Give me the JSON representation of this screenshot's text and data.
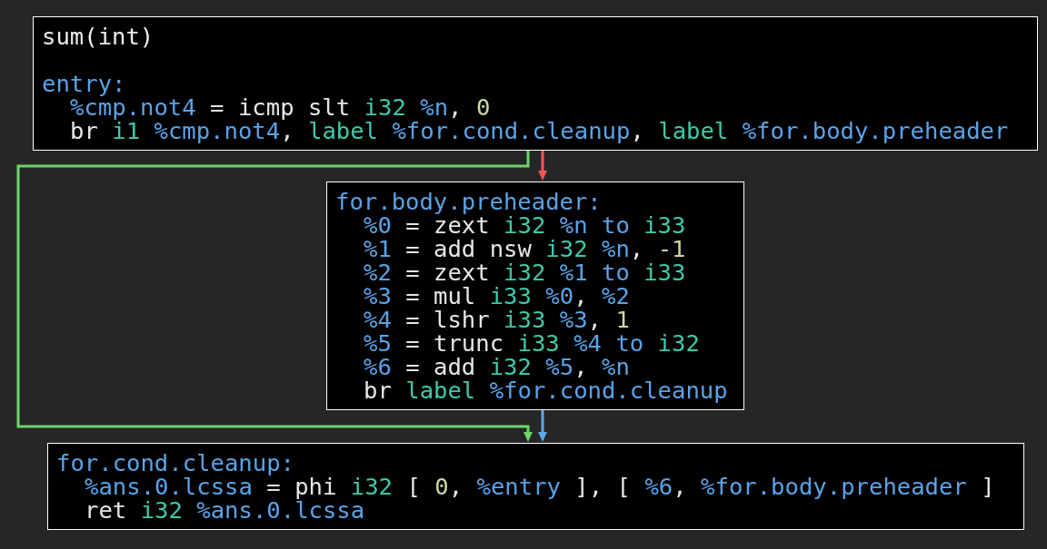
{
  "blocks": [
    {
      "title": "sum(int)",
      "label": "entry:",
      "instructions": [
        [
          {
            "t": "%cmp.not4",
            "kind": "name"
          },
          {
            "t": " = icmp slt ",
            "kind": "plain"
          },
          {
            "t": "i32",
            "kind": "type"
          },
          {
            "t": " %n",
            "kind": "name"
          },
          {
            "t": ", ",
            "kind": "plain"
          },
          {
            "t": "0",
            "kind": "number"
          }
        ],
        [
          {
            "t": "br ",
            "kind": "plain"
          },
          {
            "t": "i1",
            "kind": "type"
          },
          {
            "t": " %cmp.not4",
            "kind": "name"
          },
          {
            "t": ", ",
            "kind": "plain"
          },
          {
            "t": "label",
            "kind": "type"
          },
          {
            "t": " %for.cond.cleanup",
            "kind": "name"
          },
          {
            "t": ", ",
            "kind": "plain"
          },
          {
            "t": "label",
            "kind": "type"
          },
          {
            "t": " %for.body.preheader",
            "kind": "name"
          }
        ]
      ],
      "edges": [
        {
          "kind": "skip",
          "color": "#6ad66a"
        },
        {
          "kind": "next",
          "color": "#f05555"
        }
      ]
    },
    {
      "label": "for.body.preheader:",
      "instructions": [
        [
          {
            "t": "%0",
            "kind": "name"
          },
          {
            "t": " = zext ",
            "kind": "plain"
          },
          {
            "t": "i32",
            "kind": "type"
          },
          {
            "t": " %n to",
            "kind": "name"
          },
          {
            "t": " i33",
            "kind": "type"
          }
        ],
        [
          {
            "t": "%1",
            "kind": "name"
          },
          {
            "t": " = add nsw ",
            "kind": "plain"
          },
          {
            "t": "i32",
            "kind": "type"
          },
          {
            "t": " %n",
            "kind": "name"
          },
          {
            "t": ", ",
            "kind": "plain"
          },
          {
            "t": "-1",
            "kind": "number"
          }
        ],
        [
          {
            "t": "%2",
            "kind": "name"
          },
          {
            "t": " = zext ",
            "kind": "plain"
          },
          {
            "t": "i32",
            "kind": "type"
          },
          {
            "t": " %1 to",
            "kind": "name"
          },
          {
            "t": " i33",
            "kind": "type"
          }
        ],
        [
          {
            "t": "%3",
            "kind": "name"
          },
          {
            "t": " = mul ",
            "kind": "plain"
          },
          {
            "t": "i33",
            "kind": "type"
          },
          {
            "t": " %0",
            "kind": "name"
          },
          {
            "t": ", ",
            "kind": "plain"
          },
          {
            "t": "%2",
            "kind": "name"
          }
        ],
        [
          {
            "t": "%4",
            "kind": "name"
          },
          {
            "t": " = lshr ",
            "kind": "plain"
          },
          {
            "t": "i33",
            "kind": "type"
          },
          {
            "t": " %3",
            "kind": "name"
          },
          {
            "t": ", ",
            "kind": "plain"
          },
          {
            "t": "1",
            "kind": "number"
          }
        ],
        [
          {
            "t": "%5",
            "kind": "name"
          },
          {
            "t": " = trunc ",
            "kind": "plain"
          },
          {
            "t": "i33",
            "kind": "type"
          },
          {
            "t": " %4 to",
            "kind": "name"
          },
          {
            "t": " i32",
            "kind": "type"
          }
        ],
        [
          {
            "t": "%6",
            "kind": "name"
          },
          {
            "t": " = add ",
            "kind": "plain"
          },
          {
            "t": "i32",
            "kind": "type"
          },
          {
            "t": " %5",
            "kind": "name"
          },
          {
            "t": ", ",
            "kind": "plain"
          },
          {
            "t": "%n",
            "kind": "name"
          }
        ],
        [
          {
            "t": "br ",
            "kind": "plain"
          },
          {
            "t": "label",
            "kind": "type"
          },
          {
            "t": " %for.cond.cleanup",
            "kind": "name"
          }
        ]
      ],
      "edges": [
        {
          "kind": "next",
          "color": "#5aa8ec"
        }
      ]
    },
    {
      "label": "for.cond.cleanup:",
      "instructions": [
        [
          {
            "t": "%ans.0.lcssa",
            "kind": "name"
          },
          {
            "t": " = phi ",
            "kind": "plain"
          },
          {
            "t": "i32",
            "kind": "type"
          },
          {
            "t": " [ ",
            "kind": "plain"
          },
          {
            "t": "0",
            "kind": "number"
          },
          {
            "t": ", ",
            "kind": "plain"
          },
          {
            "t": "%entry",
            "kind": "name"
          },
          {
            "t": " ], [ ",
            "kind": "plain"
          },
          {
            "t": "%6",
            "kind": "name"
          },
          {
            "t": ", ",
            "kind": "plain"
          },
          {
            "t": "%for.body.preheader",
            "kind": "name"
          },
          {
            "t": " ]",
            "kind": "plain"
          }
        ],
        [
          {
            "t": "ret ",
            "kind": "plain"
          },
          {
            "t": "i32",
            "kind": "type"
          },
          {
            "t": " %ans.0.lcssa",
            "kind": "name"
          }
        ]
      ]
    }
  ]
}
